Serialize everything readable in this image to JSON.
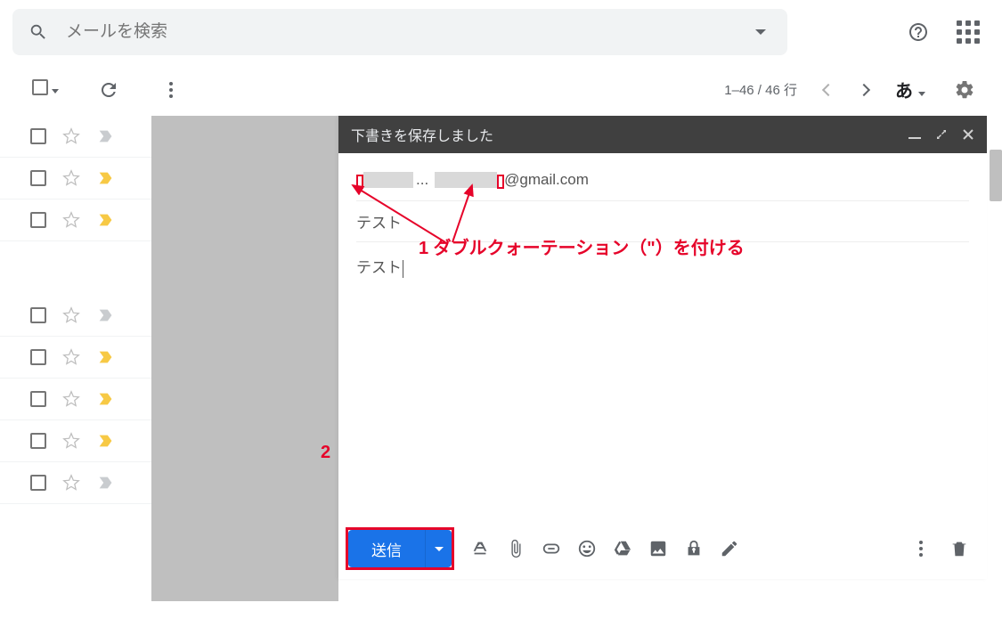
{
  "search": {
    "placeholder": "メールを検索"
  },
  "toolbar": {
    "page_info": "1–46 / 46 行",
    "lang": "あ"
  },
  "list": {
    "rows": [
      {
        "bookmark": "grey"
      },
      {
        "bookmark": "yellow"
      },
      {
        "bookmark": "yellow"
      }
    ],
    "rows2": [
      {
        "bookmark": "grey"
      },
      {
        "bookmark": "yellow"
      },
      {
        "bookmark": "yellow"
      },
      {
        "bookmark": "yellow"
      },
      {
        "bookmark": "grey"
      }
    ]
  },
  "compose": {
    "header_title": "下書きを保存しました",
    "to_suffix": "@gmail.com",
    "to_separator": "...",
    "subject": "テスト",
    "body": "テスト",
    "send_label": "送信"
  },
  "annotation": {
    "step1": "1 ダブルクォーテーション（\"）を付ける",
    "step2": "2"
  }
}
